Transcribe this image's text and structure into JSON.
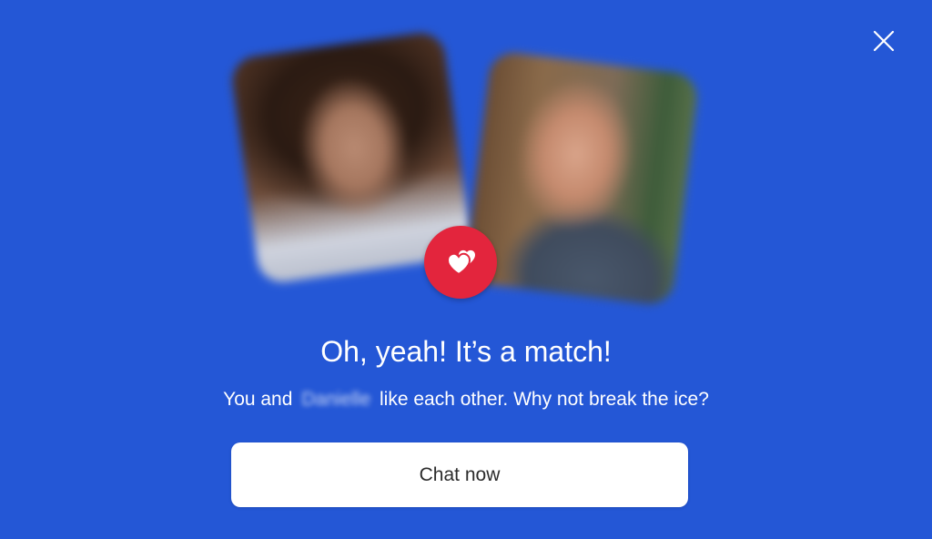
{
  "colors": {
    "background": "#2457d6",
    "badge": "#e3253d",
    "button_bg": "#ffffff",
    "text": "#ffffff"
  },
  "match": {
    "title": "Oh, yeah! It’s a match!",
    "subtitle_prefix": "You and",
    "partner_name": "Danielle",
    "subtitle_suffix": "like each other. Why not break the ice?",
    "chat_button_label": "Chat now"
  },
  "icons": {
    "close": "close-icon",
    "badge": "hearts-icon"
  }
}
